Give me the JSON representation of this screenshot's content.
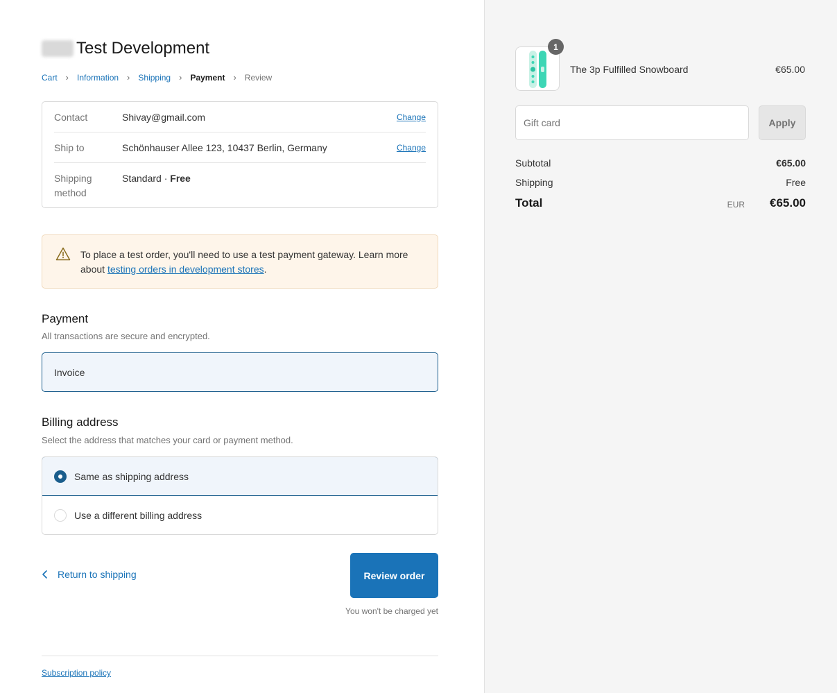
{
  "store": {
    "title": "Test Development"
  },
  "breadcrumb": {
    "items": [
      {
        "label": "Cart",
        "state": "link"
      },
      {
        "label": "Information",
        "state": "link"
      },
      {
        "label": "Shipping",
        "state": "link"
      },
      {
        "label": "Payment",
        "state": "current"
      },
      {
        "label": "Review",
        "state": "future"
      }
    ]
  },
  "review": {
    "contact": {
      "label": "Contact",
      "value": "Shivay@gmail.com",
      "action": "Change"
    },
    "ship_to": {
      "label": "Ship to",
      "value": "Schönhauser Allee 123, 10437 Berlin, Germany",
      "action": "Change"
    },
    "shipping_method": {
      "label": "Shipping method",
      "value": "Standard · ",
      "value_bold": "Free"
    }
  },
  "notice": {
    "icon": "warning-icon",
    "text": "To place a test order, you'll need to use a test payment gateway. Learn more about ",
    "link": "testing orders in development stores",
    "suffix": "."
  },
  "payment": {
    "title": "Payment",
    "subtitle": "All transactions are secure and encrypted.",
    "method": "Invoice"
  },
  "billing": {
    "title": "Billing address",
    "subtitle": "Select the address that matches your card or payment method.",
    "options": [
      {
        "label": "Same as shipping address",
        "selected": true
      },
      {
        "label": "Use a different billing address",
        "selected": false
      }
    ]
  },
  "actions": {
    "return_label": "Return to shipping",
    "review_label": "Review order",
    "charged_note": "You won't be charged yet"
  },
  "footer": {
    "policy_link": "Subscription policy"
  },
  "order_summary": {
    "product": {
      "name": "The 3p Fulfilled Snowboard",
      "price": "€65.00",
      "quantity": "1"
    },
    "gift_card": {
      "placeholder": "Gift card",
      "apply_label": "Apply"
    },
    "subtotal": {
      "label": "Subtotal",
      "value": "€65.00"
    },
    "shipping": {
      "label": "Shipping",
      "value": "Free"
    },
    "total": {
      "label": "Total",
      "currency": "EUR",
      "value": "€65.00"
    }
  },
  "colors": {
    "accent": "#1a73b8",
    "selected_bg": "#f0f5fb",
    "notice_bg": "#fef5ea"
  }
}
